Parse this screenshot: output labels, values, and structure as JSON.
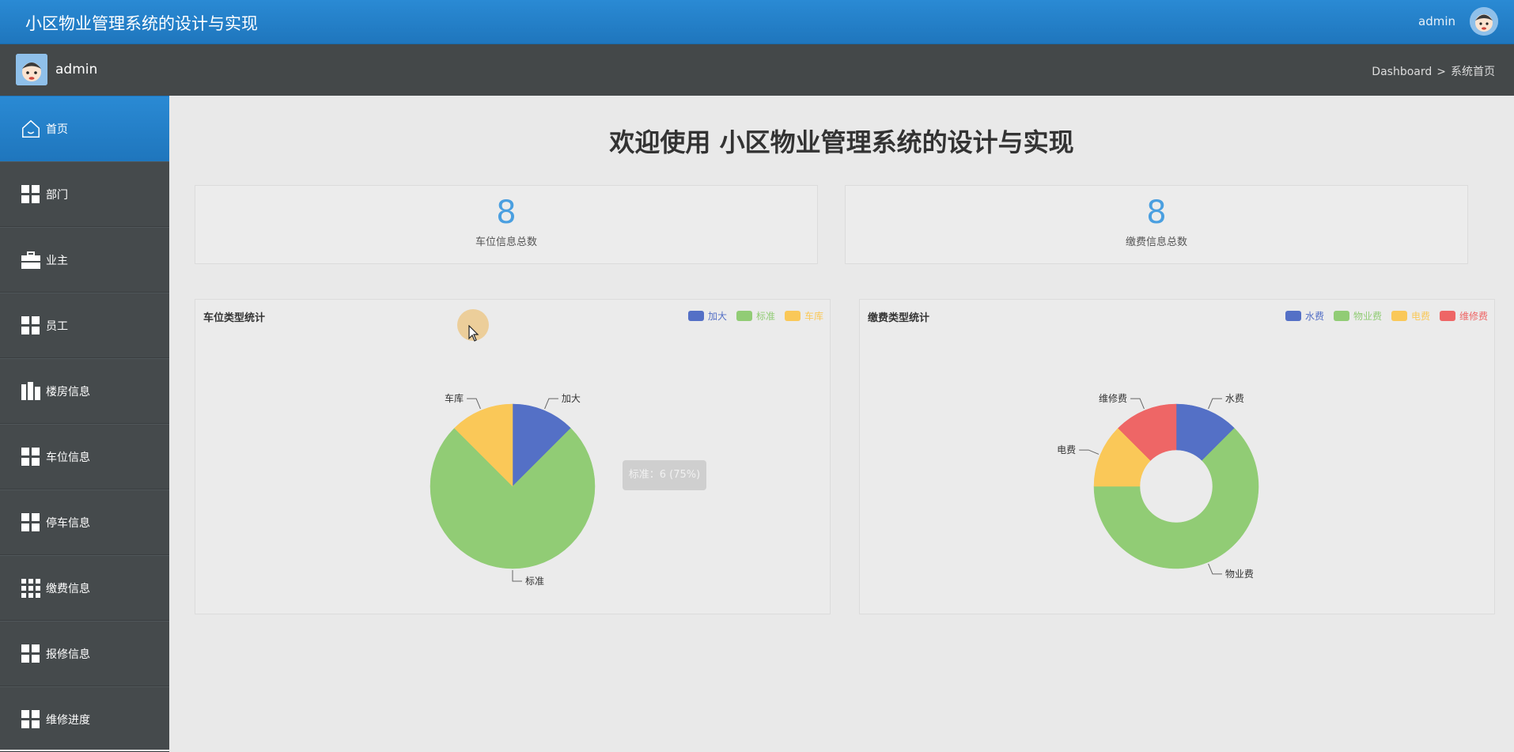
{
  "header": {
    "title": "小区物业管理系统的设计与实现",
    "user": "admin"
  },
  "subbar": {
    "user": "admin",
    "breadcrumb": {
      "parent": "Dashboard",
      "separator": ">",
      "current": "系统首页"
    }
  },
  "sidebar": {
    "items": [
      {
        "label": "首页",
        "icon": "home-icon",
        "active": true
      },
      {
        "label": "部门",
        "icon": "grid-icon"
      },
      {
        "label": "业主",
        "icon": "briefcase-icon"
      },
      {
        "label": "员工",
        "icon": "grid-icon"
      },
      {
        "label": "楼房信息",
        "icon": "building-icon"
      },
      {
        "label": "车位信息",
        "icon": "grid-icon"
      },
      {
        "label": "停车信息",
        "icon": "grid-icon"
      },
      {
        "label": "缴费信息",
        "icon": "grid9-icon"
      },
      {
        "label": "报修信息",
        "icon": "grid-icon"
      },
      {
        "label": "维修进度",
        "icon": "grid-icon"
      }
    ]
  },
  "main": {
    "welcome": "欢迎使用 小区物业管理系统的设计与实现",
    "stats": [
      {
        "value": "8",
        "label": "车位信息总数"
      },
      {
        "value": "8",
        "label": "缴费信息总数"
      }
    ],
    "tooltip": "标准：6 (75%)"
  },
  "colors": {
    "blue": "#5470c6",
    "green": "#91cc75",
    "yellow": "#fac858",
    "red": "#ee6666",
    "accent": "#2a8ad4"
  },
  "chart_data": [
    {
      "type": "pie",
      "title": "车位类型统计",
      "categories": [
        "加大",
        "标准",
        "车库"
      ],
      "values": [
        1,
        6,
        1
      ],
      "legend": "top-right",
      "colors": [
        "#5470c6",
        "#91cc75",
        "#fac858"
      ]
    },
    {
      "type": "pie",
      "variant": "donut",
      "title": "缴费类型统计",
      "categories": [
        "水费",
        "物业费",
        "电费",
        "维修费"
      ],
      "values": [
        1,
        5,
        1,
        1
      ],
      "legend": "top-right",
      "colors": [
        "#5470c6",
        "#91cc75",
        "#fac858",
        "#ee6666"
      ]
    }
  ]
}
